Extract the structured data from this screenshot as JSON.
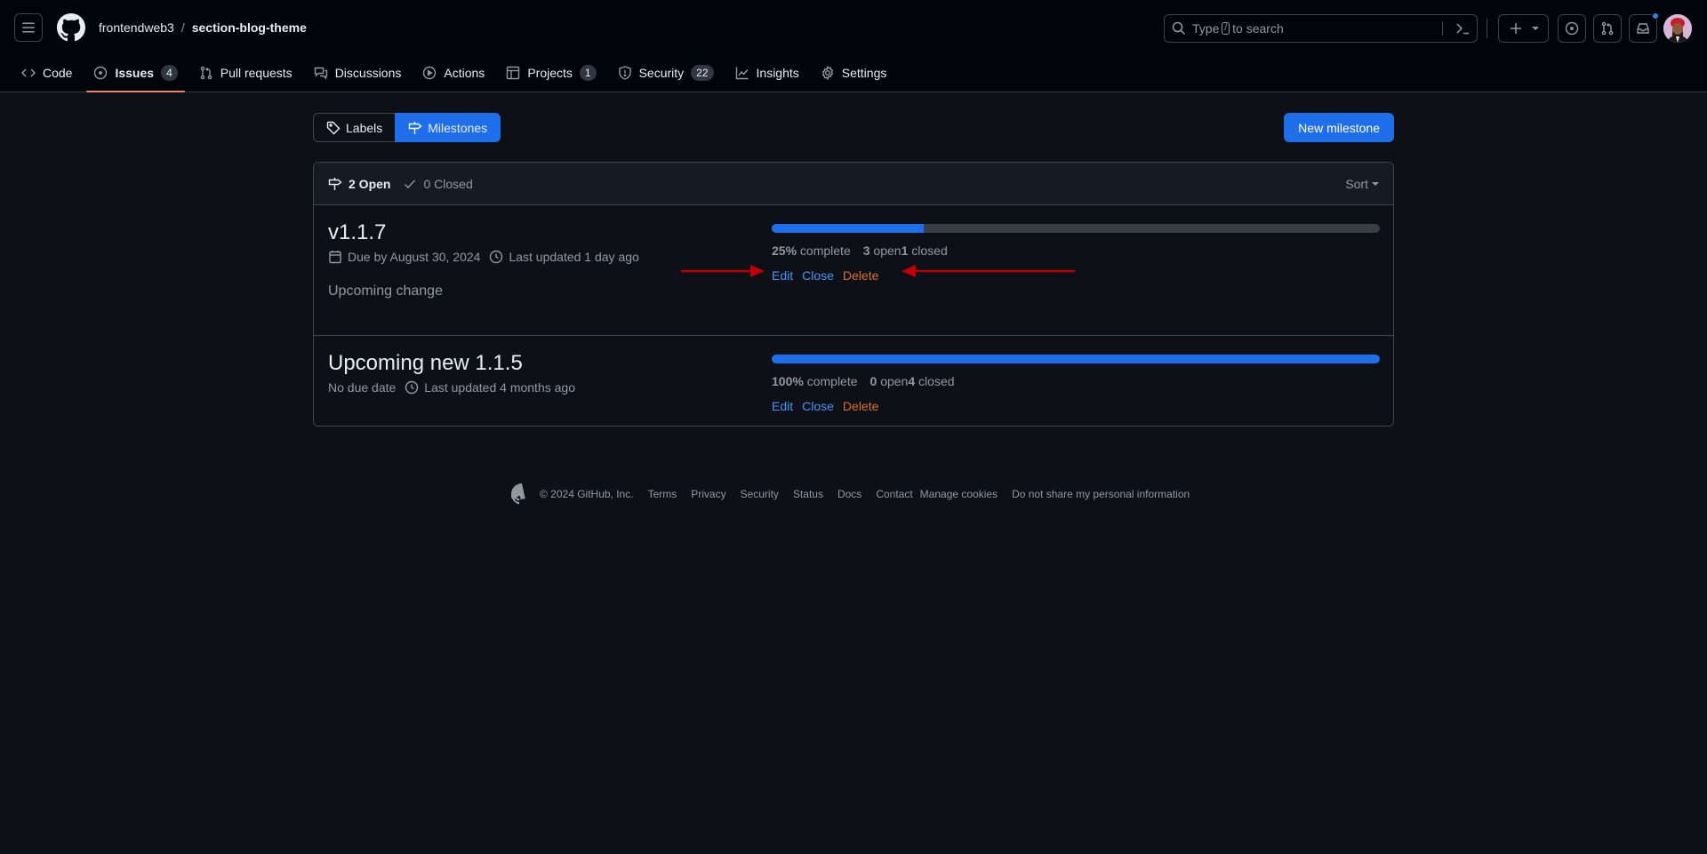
{
  "header": {
    "owner": "frontendweb3",
    "separator": "/",
    "repo": "section-blog-theme",
    "search_prefix": "Type",
    "search_key": "/",
    "search_suffix": "to search"
  },
  "tabs": [
    {
      "label": "Code",
      "icon": "code-icon"
    },
    {
      "label": "Issues",
      "icon": "issue-opened-icon",
      "counter": "4",
      "active": true
    },
    {
      "label": "Pull requests",
      "icon": "git-pull-request-icon"
    },
    {
      "label": "Discussions",
      "icon": "comment-discussion-icon"
    },
    {
      "label": "Actions",
      "icon": "play-icon"
    },
    {
      "label": "Projects",
      "icon": "table-icon",
      "counter": "1"
    },
    {
      "label": "Security",
      "icon": "shield-icon",
      "counter": "22"
    },
    {
      "label": "Insights",
      "icon": "graph-icon"
    },
    {
      "label": "Settings",
      "icon": "gear-icon"
    }
  ],
  "subnav": {
    "labels": "Labels",
    "milestones": "Milestones",
    "new_milestone": "New milestone"
  },
  "list_header": {
    "open": "2 Open",
    "closed": "0 Closed",
    "sort": "Sort"
  },
  "milestones": [
    {
      "title": "v1.1.7",
      "due": "Due by August 30, 2024",
      "updated": "Last updated 1 day ago",
      "description": "Upcoming change",
      "progress_percent": 25,
      "percent_label": "25%",
      "complete_label": "complete",
      "open_count": "3",
      "open_label": "open",
      "closed_count": "1",
      "closed_label": "closed",
      "edit": "Edit",
      "close": "Close",
      "delete": "Delete"
    },
    {
      "title": "Upcoming new 1.1.5",
      "due": "No due date",
      "updated": "Last updated 4 months ago",
      "description": "",
      "progress_percent": 100,
      "percent_label": "100%",
      "complete_label": "complete",
      "open_count": "0",
      "open_label": "open",
      "closed_count": "4",
      "closed_label": "closed",
      "edit": "Edit",
      "close": "Close",
      "delete": "Delete"
    }
  ],
  "footer": {
    "copyright": "© 2024 GitHub, Inc.",
    "links": [
      "Terms",
      "Privacy",
      "Security",
      "Status",
      "Docs",
      "Contact",
      "Manage cookies",
      "Do not share my personal information"
    ]
  },
  "colors": {
    "accent": "#1f6feb",
    "link": "#4493f8",
    "danger_link": "#db6d28",
    "active_tab_underline": "#f78166",
    "annotation_arrow": "#c00000"
  }
}
